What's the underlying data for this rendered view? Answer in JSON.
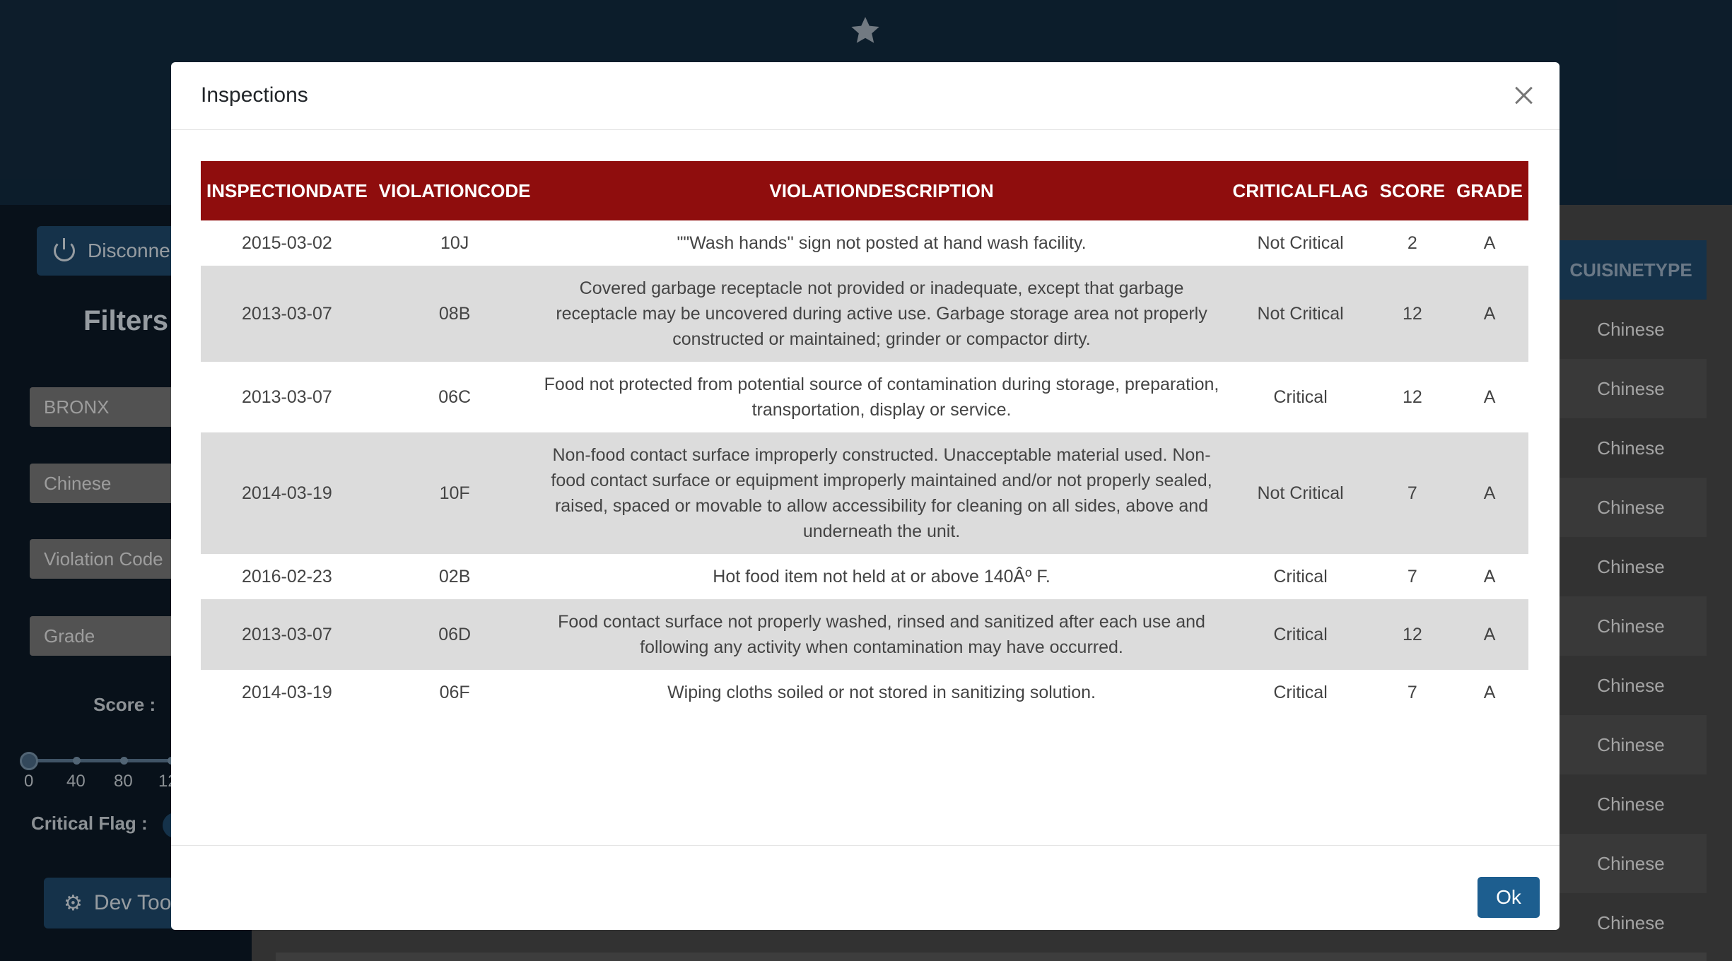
{
  "sidebar": {
    "disconnect_label": "Disconne",
    "filters_title": "Filters",
    "borough": "BRONX",
    "cuisine": "Chinese",
    "violation_code": "Violation Code",
    "grade": "Grade",
    "score_label": "Score :",
    "score_ticks": [
      "0",
      "40",
      "80",
      "12"
    ],
    "critical_flag_label": "Critical Flag :",
    "devtools_label": "Dev Too"
  },
  "background_table": {
    "header": "CUISINETYPE",
    "cells": [
      "Chinese",
      "Chinese",
      "Chinese",
      "Chinese",
      "Chinese",
      "Chinese",
      "Chinese",
      "Chinese",
      "Chinese",
      "Chinese",
      "Chinese"
    ]
  },
  "modal": {
    "title": "Inspections",
    "ok_label": "Ok",
    "columns": [
      "INSPECTIONDATE",
      "VIOLATIONCODE",
      "VIOLATIONDESCRIPTION",
      "CRITICALFLAG",
      "SCORE",
      "GRADE"
    ],
    "rows": [
      {
        "date": "2015-03-02",
        "code": "10J",
        "description": "\"\"Wash hands'' sign not posted at hand wash facility.",
        "flag": "Not Critical",
        "score": "2",
        "grade": "A"
      },
      {
        "date": "2013-03-07",
        "code": "08B",
        "description": "Covered garbage receptacle not provided or inadequate, except that garbage receptacle may be uncovered during active use. Garbage storage area not properly constructed or maintained; grinder or compactor dirty.",
        "flag": "Not Critical",
        "score": "12",
        "grade": "A"
      },
      {
        "date": "2013-03-07",
        "code": "06C",
        "description": "Food not protected from potential source of contamination during storage, preparation, transportation, display or service.",
        "flag": "Critical",
        "score": "12",
        "grade": "A"
      },
      {
        "date": "2014-03-19",
        "code": "10F",
        "description": "Non-food contact surface improperly constructed. Unacceptable material used. Non-food contact surface or equipment improperly maintained and/or not properly sealed, raised, spaced or movable to allow accessibility for cleaning on all sides, above and underneath the unit.",
        "flag": "Not Critical",
        "score": "7",
        "grade": "A"
      },
      {
        "date": "2016-02-23",
        "code": "02B",
        "description": "Hot food item not held at or above 140Âº F.",
        "flag": "Critical",
        "score": "7",
        "grade": "A"
      },
      {
        "date": "2013-03-07",
        "code": "06D",
        "description": "Food contact surface not properly washed, rinsed and sanitized after each use and following any activity when contamination may have occurred.",
        "flag": "Critical",
        "score": "12",
        "grade": "A"
      },
      {
        "date": "2014-03-19",
        "code": "06F",
        "description": "Wiping cloths soiled or not stored in sanitizing solution.",
        "flag": "Critical",
        "score": "7",
        "grade": "A"
      }
    ]
  },
  "colors": {
    "header_red": "#8f0d0d",
    "primary_blue": "#1d5e8f",
    "navy": "#132b40"
  }
}
